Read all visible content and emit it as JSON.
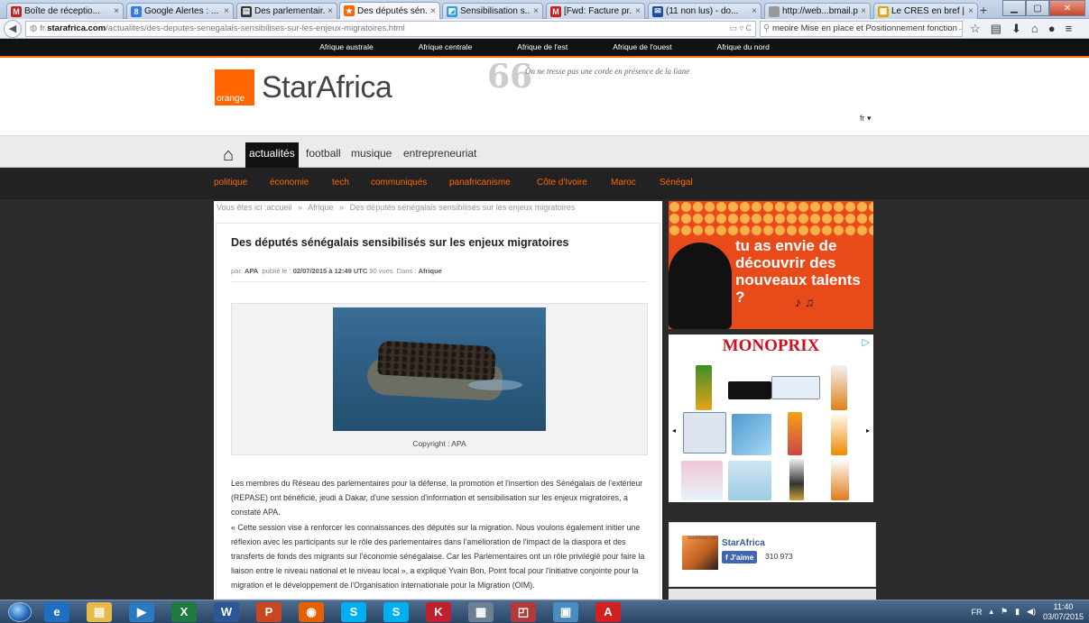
{
  "browser": {
    "tabs": [
      {
        "label": "Boîte de réceptio...",
        "icon": "gmail-icon",
        "color": "#c5221f",
        "glyph": "M"
      },
      {
        "label": "Google Alertes : ...",
        "icon": "google-icon",
        "color": "#3b78e7",
        "glyph": "8"
      },
      {
        "label": "Des parlementair...",
        "icon": "doc-icon",
        "color": "#333333",
        "glyph": "▤"
      },
      {
        "label": "Des députés sén...",
        "icon": "starafrica-icon",
        "color": "#ff6600",
        "glyph": "★"
      },
      {
        "label": "Sensibilisation s...",
        "icon": "page-icon",
        "color": "#2c9fd8",
        "glyph": "◩"
      },
      {
        "label": "[Fwd: Facture pr...",
        "icon": "gmail-icon",
        "color": "#c5221f",
        "glyph": "M"
      },
      {
        "label": "(11 non lus) - do...",
        "icon": "mail-icon",
        "color": "#1e4ea1",
        "glyph": "✉"
      },
      {
        "label": "http://web...bmail.php",
        "icon": "blank-icon",
        "color": "#999999",
        "glyph": ""
      },
      {
        "label": "Le CRES en bref |...",
        "icon": "cres-icon",
        "color": "#e2a300",
        "glyph": "▦"
      }
    ],
    "new_tab": "+",
    "url_prefix": "fr.",
    "url_host": "starafrica.com",
    "url_path": "/actualites/des-deputes-senegalais-sensibilises-sur-les-enjeux-migratoires.html",
    "search_value": "meoire Mise en place et Positionnement fonction"
  },
  "site": {
    "regions": [
      "Afrique australe",
      "Afrique centrale",
      "Afrique de l'est",
      "Afrique de l'ouest",
      "Afrique du nord"
    ],
    "logo_badge": "orange",
    "logo_text": "StarAfrica",
    "quote_mark": "66",
    "quote": "On ne tresse pas une corde en présence de la liane",
    "lang": "fr ▾",
    "menu": [
      "actualités",
      "football",
      "musique",
      "entrepreneuriat"
    ],
    "categories": [
      "politique",
      "économie",
      "tech",
      "communiqués",
      "panafricanisme",
      "Côte d'Ivoire",
      "Maroc",
      "Sénégal"
    ]
  },
  "breadcrumb": {
    "prefix": "Vous êtes ici :",
    "items": [
      "accueil",
      "Afrique",
      "Des députés sénégalais sensibilisés sur les enjeux migratoires"
    ],
    "sep": "»"
  },
  "article": {
    "title": "Des députés sénégalais sensibilisés sur les enjeux migratoires",
    "meta_by_label": "par:",
    "meta_by": "APA",
    "meta_published_label": "publié le :",
    "meta_date": "02/07/2015 à 12:49 UTC",
    "meta_views": "90 vues",
    "meta_in_label": "Dans :",
    "meta_in": "Afrique",
    "caption": "Copyright : APA",
    "paragraphs": [
      "Les membres du Réseau des parlementaires pour la défense, la promotion et l'insertion des Sénégalais de l'extérieur (REPASE) ont bénéficié, jeudi à Dakar, d'une session d'information et sensibilisation sur les enjeux migratoires, a constaté APA.",
      "« Cette session vise à renforcer les connaissances des députés sur la migration. Nous voulons également initier une réflexion avec les participants sur le rôle des parlementaires dans l'amélioration de l'impact de la diaspora et des transferts de fonds des migrants sur l'économie sénégalaise. Car les Parlementaires ont un rôle privilégié pour faire la liaison entre le niveau national et le niveau local », a expliqué Yvain Bon, Point focal pour l'initiative conjointe pour la migration et le développement de l'Organisation internationale pour la Migration (OIM)."
    ]
  },
  "sidebar": {
    "ad1_text": "tu as envie de découvrir des nouveaux talents ?",
    "ad2_brand": "MONOPRIX",
    "ad2_choice": "▷",
    "ad2_prev": "◂",
    "ad2_next": "▸",
    "fb_small": "StarAfrica.com",
    "fb_name": "StarAfrica",
    "fb_like": "J'aime",
    "fb_count": "310 973"
  },
  "taskbar": {
    "lang": "FR",
    "time": "11:40",
    "date": "03/07/2015",
    "apps": [
      {
        "name": "ie-icon",
        "color": "#1e6fc2",
        "glyph": "e"
      },
      {
        "name": "explorer-icon",
        "color": "#e6b94a",
        "glyph": "▤"
      },
      {
        "name": "media-icon",
        "color": "#2a7ac0",
        "glyph": "▶"
      },
      {
        "name": "excel-icon",
        "color": "#1f7a3d",
        "glyph": "X"
      },
      {
        "name": "word-icon",
        "color": "#2b5797",
        "glyph": "W"
      },
      {
        "name": "powerpoint-icon",
        "color": "#c8471f",
        "glyph": "P"
      },
      {
        "name": "firefox-icon",
        "color": "#e66000",
        "glyph": "◉"
      },
      {
        "name": "skype-icon",
        "color": "#00aff0",
        "glyph": "S"
      },
      {
        "name": "skype-icon",
        "color": "#00aff0",
        "glyph": "S"
      },
      {
        "name": "k-app-icon",
        "color": "#c21f2d",
        "glyph": "K"
      },
      {
        "name": "calculator-icon",
        "color": "#6e7f93",
        "glyph": "▦"
      },
      {
        "name": "chart-app-icon",
        "color": "#b23a3a",
        "glyph": "◰"
      },
      {
        "name": "control-icon",
        "color": "#4a8cc2",
        "glyph": "▣"
      },
      {
        "name": "acrobat-icon",
        "color": "#d21f1f",
        "glyph": "A"
      }
    ]
  },
  "colors": {
    "accent": "#ff6600",
    "facebook": "#3b5998"
  }
}
